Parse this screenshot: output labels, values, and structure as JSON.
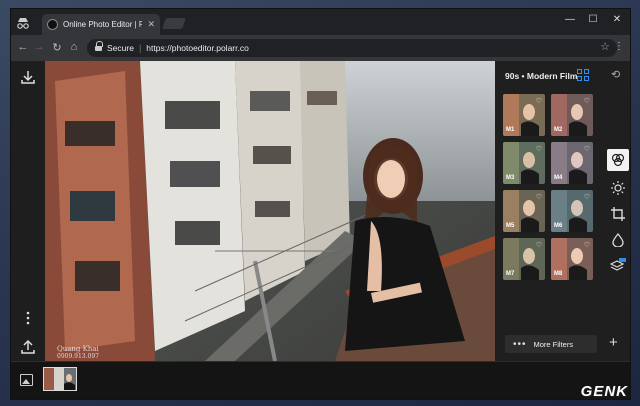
{
  "browser": {
    "tab_title": "Online Photo Editor | Polarr",
    "tab_close": "✕",
    "secure_label": "Secure",
    "separator": "|",
    "url": "https://photoeditor.polarr.co",
    "window_controls": {
      "minimize": "—",
      "maximize": "☐",
      "close": "✕"
    },
    "nav": {
      "back": "←",
      "forward": "→",
      "reload": "↻",
      "home": "⌂",
      "bookmark": "☆",
      "menu": "⋮"
    }
  },
  "left_toolbar": {
    "import_icon": "download-icon",
    "more_icon": "vertical-dots-icon",
    "export_icon": "upload-icon"
  },
  "filters": {
    "collection_title": "90s • Modern Film",
    "items": [
      {
        "label": "M1",
        "color": "#7a6b55"
      },
      {
        "label": "M2",
        "color": "#6e5a58"
      },
      {
        "label": "M3",
        "color": "#5f6d5e"
      },
      {
        "label": "M4",
        "color": "#6b6670"
      },
      {
        "label": "M5",
        "color": "#6a6455"
      },
      {
        "label": "M6",
        "color": "#56696e"
      },
      {
        "label": "M7",
        "color": "#5e6656"
      },
      {
        "label": "M8",
        "color": "#7a5e58"
      }
    ],
    "heart_glyph": "♡",
    "more_filters_label": "More Filters",
    "more_dots": "•••",
    "add_glyph": "+"
  },
  "tools": {
    "filters_glyph": "◎",
    "adjust_glyph": "✺",
    "crop_glyph": "⌗",
    "retouch_glyph": "💧",
    "layers_glyph": "◈",
    "new_badge": "NEW"
  },
  "photo": {
    "watermark_line1": "Quang Khai",
    "watermark_line2": "0909.913.097"
  },
  "brand_watermark": "GENK",
  "colors": {
    "accent": "#2e8ff0",
    "panel": "#1f1f1f",
    "chrome_tab": "#35363a"
  }
}
